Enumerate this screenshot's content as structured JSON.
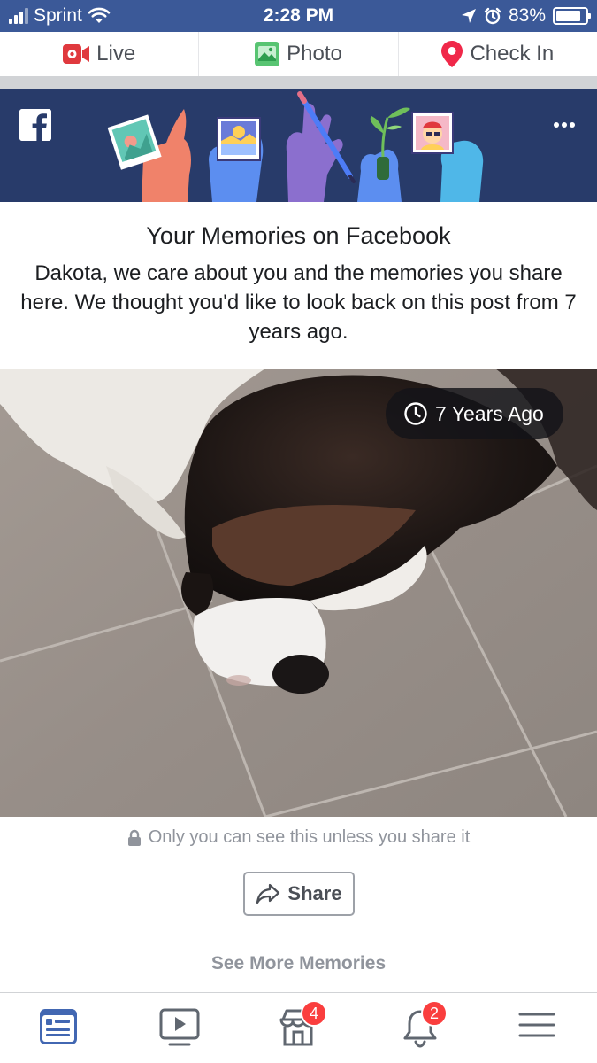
{
  "status_bar": {
    "carrier": "Sprint",
    "time": "2:28 PM",
    "battery": "83%",
    "battery_level": 0.83,
    "signal_bars": 3,
    "signal_max": 4
  },
  "composer": {
    "live_label": "Live",
    "photo_label": "Photo",
    "checkin_label": "Check In"
  },
  "memory": {
    "title": "Your Memories on Facebook",
    "body": "Dakota, we care about you and the memories you share here. We thought you'd like to look back on this post from 7 years ago.",
    "badge": "7 Years Ago",
    "privacy": "Only you can see this unless you share it",
    "share_label": "Share",
    "see_more": "See More Memories"
  },
  "tab_bar": {
    "tabs": [
      {
        "name": "news-feed",
        "icon": "news-feed-icon",
        "active": true
      },
      {
        "name": "watch",
        "icon": "video-play-icon",
        "active": false
      },
      {
        "name": "marketplace",
        "icon": "marketplace-icon",
        "active": false,
        "badge": "4"
      },
      {
        "name": "notifications",
        "icon": "bell-icon",
        "active": false,
        "badge": "2"
      },
      {
        "name": "menu",
        "icon": "hamburger-menu-icon",
        "active": false
      }
    ]
  },
  "colors": {
    "brand_blue": "#3b5998",
    "banner_blue": "#283b6a",
    "badge_red": "#fa3e3e",
    "active_tab": "#4267b2",
    "inactive_tab": "#606770"
  }
}
